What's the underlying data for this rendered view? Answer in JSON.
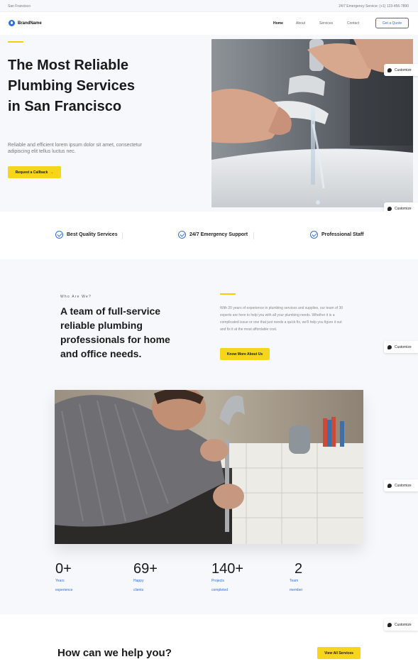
{
  "topbar": {
    "location": "San Francisco",
    "phone": "24/7 Emergency Service: (+1) 123-456-7890"
  },
  "nav": {
    "brand": "BrandName",
    "links": [
      "Home",
      "About",
      "Services",
      "Contact"
    ],
    "cta": "Get a Quote"
  },
  "hero": {
    "title": "The Most Reliable Plumbing Services in San Francisco",
    "subtitle": "Reliable and efficient lorem ipsum dolor sit amet, consectetur adipiscing elit tellus luctus nec.",
    "button": "Request a Callback",
    "button_icon": "arrow-right"
  },
  "customize_label": "Customize",
  "features": [
    {
      "label": "Best Quality Services",
      "icon": "check-circle"
    },
    {
      "label": "24/7 Emergency Support",
      "icon": "check-circle"
    },
    {
      "label": "Professional Staff",
      "icon": "check-circle"
    }
  ],
  "about": {
    "eyebrow": "Who Are We?",
    "title": "A team of full-service reliable plumbing professionals for home and office needs.",
    "text": "With 20 years of experience in plumbing services and supplies, our team of 30 experts are here to help you with all your plumbing needs. Whether it is a complicated issue or one that just needs a quick fix, we'll help you figure it out and fix it at the most affordable cost.",
    "button": "Know More About Us"
  },
  "stats": [
    {
      "value": "0+",
      "line1": "Years",
      "line2": "experience"
    },
    {
      "value": "69+",
      "line1": "Happy",
      "line2": "clients"
    },
    {
      "value": "140+",
      "line1": "Projects",
      "line2": "completed"
    },
    {
      "value": "2",
      "line1": "Team",
      "line2": "member"
    }
  ],
  "services": {
    "title": "How can we help you?",
    "button": "View All Services"
  },
  "colors": {
    "accent_yellow": "#f7d51c",
    "brand_blue": "#2e6fe0",
    "section_bg": "#f7f8fb"
  }
}
